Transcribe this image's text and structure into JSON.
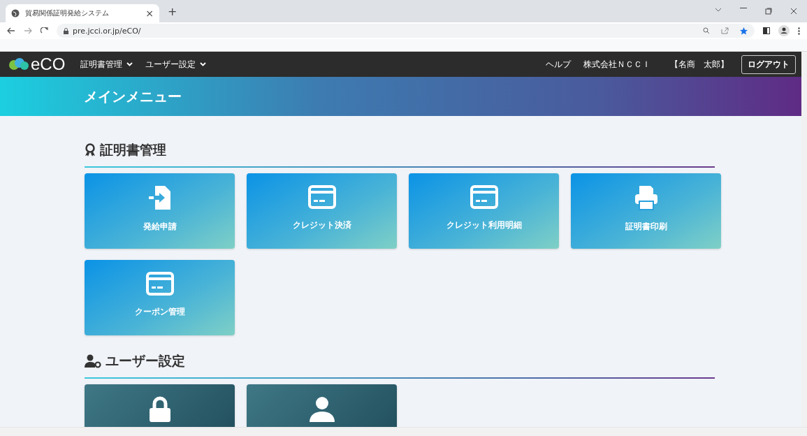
{
  "browser": {
    "tab_title": "貿易関係証明発給システム",
    "tab_close": "×",
    "new_tab": "+",
    "url": "pre.jcci.or.jp/eCO/"
  },
  "navbar": {
    "logo": "eCO",
    "menus": [
      {
        "label": "証明書管理"
      },
      {
        "label": "ユーザー設定"
      }
    ],
    "help": "ヘルプ",
    "company": "株式会社ＮＣＣＩ",
    "user": "【名商　太郎】",
    "logout": "ログアウト"
  },
  "banner": {
    "title": "メインメニュー"
  },
  "sections": [
    {
      "kind": "certificate",
      "title": "証明書管理",
      "tiles": [
        {
          "kind": "apply",
          "label": "発給申請"
        },
        {
          "kind": "payment",
          "label": "クレジット決済"
        },
        {
          "kind": "payment",
          "label": "クレジット利用明細"
        },
        {
          "kind": "print",
          "label": "証明書印刷"
        },
        {
          "kind": "payment",
          "label": "クーポン管理"
        }
      ]
    },
    {
      "kind": "user",
      "title": "ユーザー設定",
      "tiles": [
        {
          "kind": "password"
        },
        {
          "kind": "profile"
        }
      ]
    }
  ]
}
